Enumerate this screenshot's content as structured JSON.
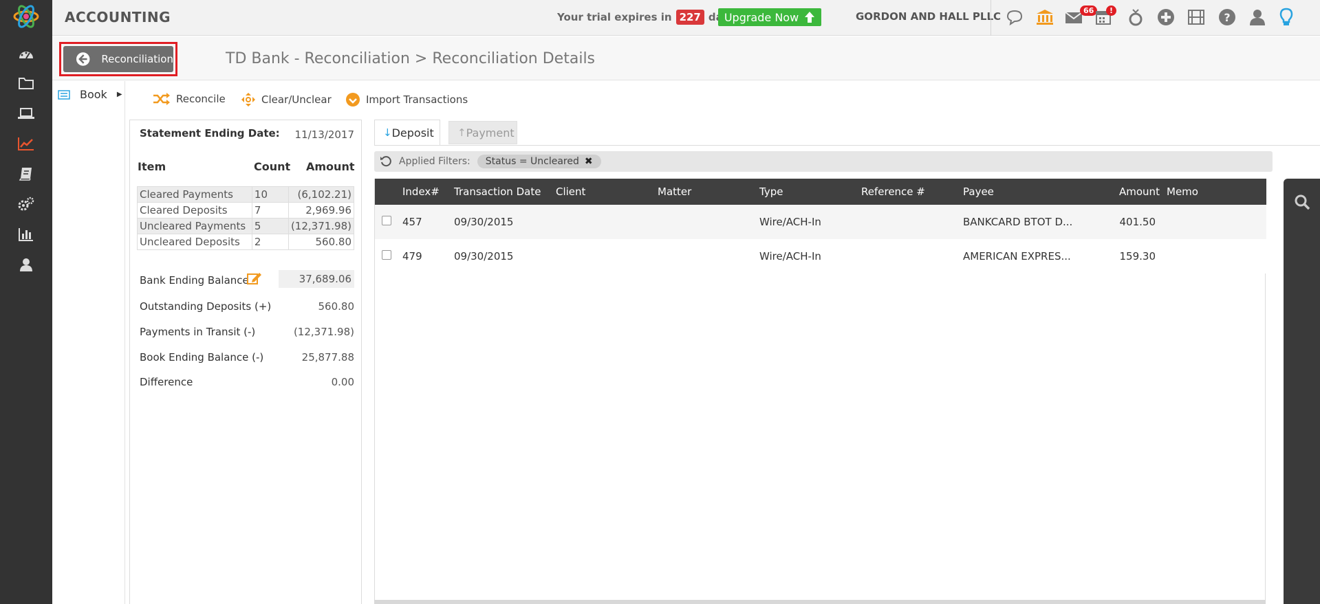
{
  "header": {
    "app_title": "ACCOUNTING",
    "trial_prefix": "Your trial expires in",
    "trial_days": "227",
    "trial_suffix": "days.",
    "upgrade_label": "Upgrade Now",
    "firm_name": "GORDON AND HALL PLLC",
    "messages_badge": "66",
    "calendar_badge": "!",
    "icons": [
      "chat-icon",
      "bank-icon",
      "mail-icon",
      "calendar-icon",
      "ring-icon",
      "plus-icon",
      "film-icon",
      "help-icon",
      "user-icon",
      "bulb-icon"
    ]
  },
  "sidebar": {
    "icons": [
      "dashboard-icon",
      "folder-icon",
      "laptop-icon",
      "chart-line-icon",
      "book-icon",
      "settings-icon",
      "bar-chart-icon",
      "user-icon"
    ]
  },
  "subheader": {
    "back_label": "Reconciliation",
    "breadcrumb": "TD Bank - Reconciliation > Reconciliation Details"
  },
  "book_menu": {
    "label": "Book"
  },
  "toolbar": {
    "reconcile": "Reconcile",
    "clear_unclear": "Clear/Unclear",
    "import": "Import Transactions"
  },
  "summary": {
    "statement_label": "Statement Ending Date:",
    "statement_date": "11/13/2017",
    "col_item": "Item",
    "col_count": "Count",
    "col_amount": "Amount",
    "rows": [
      {
        "item": "Cleared Payments",
        "count": "10",
        "amount": "(6,102.21)"
      },
      {
        "item": "Cleared Deposits",
        "count": "7",
        "amount": "2,969.96"
      },
      {
        "item": "Uncleared Payments",
        "count": "5",
        "amount": "(12,371.98)"
      },
      {
        "item": "Uncleared Deposits",
        "count": "2",
        "amount": "560.80"
      }
    ],
    "bank_ending_label": "Bank Ending Balance",
    "bank_ending_value": "37,689.06",
    "outstanding_label": "Outstanding Deposits (+)",
    "outstanding_value": "560.80",
    "transit_label": "Payments in Transit (-)",
    "transit_value": "(12,371.98)",
    "book_ending_label": "Book Ending Balance (-)",
    "book_ending_value": "25,877.88",
    "difference_label": "Difference",
    "difference_value": "0.00"
  },
  "tabs": {
    "deposit": "Deposit",
    "payment": "Payment"
  },
  "filters": {
    "label": "Applied Filters:",
    "chip": "Status = Uncleared"
  },
  "grid": {
    "columns": [
      "Index#",
      "Transaction Date",
      "Client",
      "Matter",
      "Type",
      "Reference #",
      "Payee",
      "Amount",
      "Memo"
    ],
    "rows": [
      {
        "index": "457",
        "date": "09/30/2015",
        "client": "",
        "matter": "",
        "type": "Wire/ACH-In",
        "reference": "",
        "payee": "BANKCARD BTOT D...",
        "amount": "401.50",
        "memo": ""
      },
      {
        "index": "479",
        "date": "09/30/2015",
        "client": "",
        "matter": "",
        "type": "Wire/ACH-In",
        "reference": "",
        "payee": "AMERICAN EXPRES...",
        "amount": "159.30",
        "memo": ""
      }
    ]
  },
  "colors": {
    "sidebar_bg": "#333333",
    "accent_orange": "#f29a1f",
    "upgrade_green": "#3cb83c",
    "badge_red": "#e01e24",
    "grid_header": "#404040"
  }
}
